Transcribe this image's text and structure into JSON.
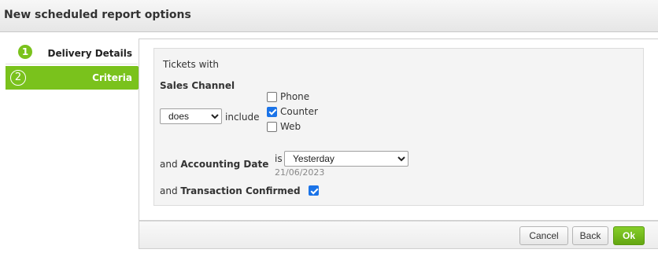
{
  "dialog": {
    "title": "New scheduled report options"
  },
  "steps": [
    {
      "number": "1",
      "label": "Delivery Details"
    },
    {
      "number": "2",
      "label": "Criteria"
    }
  ],
  "criteria": {
    "heading": "Tickets with",
    "sales_channel": {
      "label": "Sales Channel",
      "operator_selected": "does",
      "operator_options": [
        "does"
      ],
      "include_label": "include",
      "options": [
        {
          "label": "Phone",
          "checked": false
        },
        {
          "label": "Counter",
          "checked": true
        },
        {
          "label": "Web",
          "checked": false
        }
      ]
    },
    "accounting_date": {
      "prefix": "and ",
      "label": "Accounting Date",
      "is_label": "is",
      "selected": "Yesterday",
      "options": [
        "Yesterday"
      ],
      "resolved_date": "21/06/2023"
    },
    "transaction_confirmed": {
      "prefix": "and ",
      "label": "Transaction Confirmed",
      "checked": true
    }
  },
  "footer": {
    "cancel_label": "Cancel",
    "back_label": "Back",
    "ok_label": "Ok"
  },
  "colors": {
    "accent_green": "#7ac21c",
    "checkbox_blue": "#1a73e8"
  }
}
